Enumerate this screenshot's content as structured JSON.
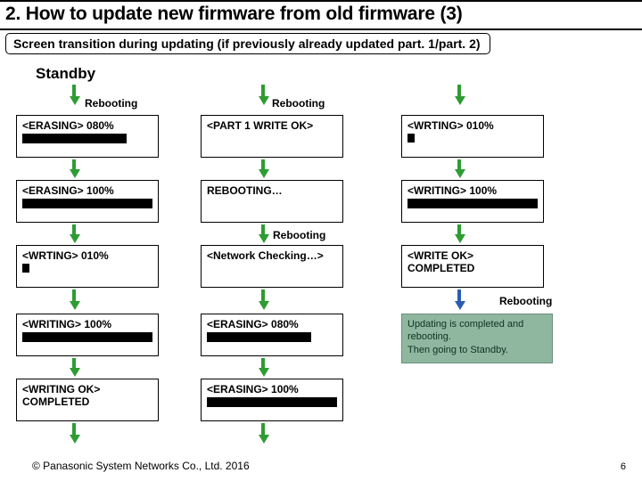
{
  "header": {
    "title": "2. How to update new firmware from old firmware (3)",
    "subtitle": "Screen transition during updating  (if previously already updated part. 1/part. 2)"
  },
  "labels": {
    "standby": "Standby",
    "rebooting": "Rebooting"
  },
  "col1": {
    "b1": {
      "text": "<ERASING> 080%",
      "barPct": 80
    },
    "b2": {
      "text": "<ERASING> 100%",
      "barPct": 100
    },
    "b3": {
      "text": "<WRTING> 010%",
      "tick": true
    },
    "b4": {
      "text": "<WRITING> 100%",
      "barPct": 100
    },
    "b5": {
      "line1": "<WRITING OK>",
      "line2": "COMPLETED"
    }
  },
  "col2": {
    "b1": {
      "text": "<PART 1 WRITE OK>"
    },
    "b2": {
      "text": "REBOOTING…"
    },
    "b3": {
      "text": "<Network Checking…>"
    },
    "b4": {
      "text": "<ERASING> 080%",
      "barPct": 80
    },
    "b5": {
      "text": "<ERASING> 100%",
      "barPct": 100
    }
  },
  "col3": {
    "b1": {
      "text": "<WRTING> 010%",
      "tick": true
    },
    "b2": {
      "text": "<WRITING> 100%",
      "barPct": 100
    },
    "b3": {
      "line1": "<WRITE OK>",
      "line2": "COMPLETED"
    }
  },
  "result": {
    "line1": "Updating is completed and rebooting.",
    "line2": "Then going to Standby."
  },
  "footer": {
    "copyright": "© Panasonic System Networks Co., Ltd.  2016",
    "page": "6"
  }
}
